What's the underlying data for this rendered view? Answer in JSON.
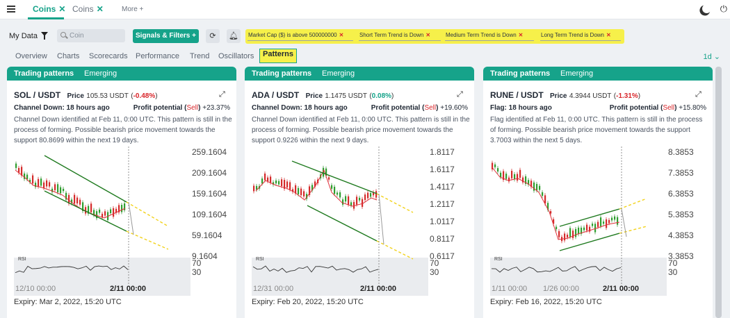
{
  "top_tabs": [
    {
      "label": "Coins",
      "closable": true,
      "active": true
    },
    {
      "label": "Coins",
      "closable": true,
      "active": false
    },
    {
      "label": "More +",
      "closable": false,
      "active": false
    }
  ],
  "filterbar": {
    "my_data_label": "My Data",
    "search_placeholder": "Coin",
    "signals_label": "Signals & Filters",
    "filters": [
      "Market Cap ($) is above 500000000",
      "Short Term Trend is Down",
      "Medium Term Trend is Down",
      "Long Term Trend is Down"
    ]
  },
  "subtabs": [
    "Overview",
    "Charts",
    "Scorecards",
    "Performance",
    "Trend",
    "Oscillators",
    "Patterns"
  ],
  "active_subtab": "Patterns",
  "interval": "1d",
  "icons": {
    "theme": "moon-icon",
    "power": "power-icon",
    "filter": "funnel-icon",
    "search": "search-icon",
    "refresh": "refresh-icon",
    "alert": "bell-icon",
    "share": "share-icon"
  },
  "colors": {
    "accent": "#16a38a",
    "highlight": "#f6f04a",
    "sell": "#d8262b",
    "buy": "#16a38a"
  },
  "cards": [
    {
      "tab_trading": "Trading patterns",
      "tab_emerging": "Emerging",
      "pair": "SOL / USDT",
      "price_label": "Price",
      "price": "105.53 USDT",
      "change": "-0.48%",
      "change_dir": "down",
      "pattern": "Channel Down: 18 hours ago",
      "profit_label": "Profit potential",
      "profit_side": "Sell",
      "profit_pct": "+23.37%",
      "description": "Channel Down identified at Feb 11, 0:00 UTC. This pattern is still in the process of forming. Possible bearish price movement towards the support 80.8699 within the next 19 days.",
      "y_ticks": [
        "259.1604",
        "209.1604",
        "159.1604",
        "109.1604",
        "59.1604",
        "9.1604"
      ],
      "x_ticks": [
        "12/10 00:00",
        "2/11 00:00"
      ],
      "rsi_label": "RSI",
      "rsi_ticks": [
        "70",
        "30"
      ],
      "expiry": "Expiry: Mar 2, 2022, 15:20 UTC"
    },
    {
      "tab_trading": "Trading patterns",
      "tab_emerging": "Emerging",
      "pair": "ADA / USDT",
      "price_label": "Price",
      "price": "1.1475 USDT",
      "change": "0.08%",
      "change_dir": "up",
      "pattern": "Channel Down: 18 hours ago",
      "profit_label": "Profit potential",
      "profit_side": "Sell",
      "profit_pct": "+19.60%",
      "description": "Channel Down identified at Feb 11, 0:00 UTC. This pattern is still in the process of forming. Possible bearish price movement towards the support 0.9226 within the next 9 days.",
      "y_ticks": [
        "1.8117",
        "1.6117",
        "1.4117",
        "1.2117",
        "1.0117",
        "0.8117",
        "0.6117"
      ],
      "x_ticks": [
        "12/31 00:00",
        "2/11 00:00"
      ],
      "rsi_label": "RSI",
      "rsi_ticks": [
        "70",
        "30"
      ],
      "expiry": "Expiry: Feb 20, 2022, 15:20 UTC"
    },
    {
      "tab_trading": "Trading patterns",
      "tab_emerging": "Emerging",
      "pair": "RUNE / USDT",
      "price_label": "Price",
      "price": "4.3944 USDT",
      "change": "-1.31%",
      "change_dir": "down",
      "pattern": "Flag: 18 hours ago",
      "profit_label": "Profit potential",
      "profit_side": "Sell",
      "profit_pct": "+15.80%",
      "description": "Flag identified at Feb 11, 0:00 UTC. This pattern is still in the process of forming. Possible bearish price movement towards the support 3.7003 within the next 5 days.",
      "y_ticks": [
        "8.3853",
        "7.3853",
        "6.3853",
        "5.3853",
        "4.3853",
        "3.3853"
      ],
      "x_ticks": [
        "1/11 00:00",
        "1/26 00:00",
        "2/11 00:00"
      ],
      "rsi_label": "RSI",
      "rsi_ticks": [
        "70",
        "30"
      ],
      "expiry": "Expiry: Feb 16, 2022, 15:20 UTC"
    }
  ]
}
